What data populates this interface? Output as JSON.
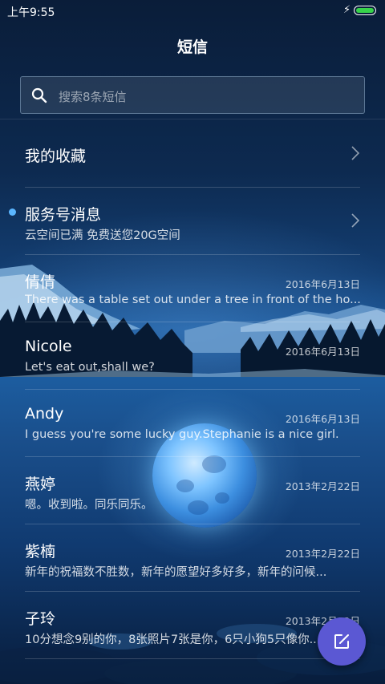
{
  "status_bar": {
    "time": "上午9:55"
  },
  "header": {
    "title": "短信"
  },
  "search": {
    "placeholder": "搜索8条短信"
  },
  "conversations": [
    {
      "name": "我的收藏",
      "snippet": "",
      "date": "",
      "chevron": true,
      "unread": false
    },
    {
      "name": "服务号消息",
      "snippet": "云空间已满 免费送您20G空间",
      "date": "",
      "chevron": true,
      "unread": true
    },
    {
      "name": "倩倩",
      "snippet": "There was a table set out under a tree in front of the ho...",
      "date": "2016年6月13日",
      "chevron": false,
      "unread": false
    },
    {
      "name": "Nicole",
      "snippet": "Let's eat out,shall we?",
      "date": "2016年6月13日",
      "chevron": false,
      "unread": false
    },
    {
      "name": "Andy",
      "snippet": "I guess you're some lucky guy.Stephanie is a nice girl.",
      "date": "2016年6月13日",
      "chevron": false,
      "unread": false
    },
    {
      "name": "燕婷",
      "snippet": "嗯。收到啦。同乐同乐。",
      "date": "2013年2月22日",
      "chevron": false,
      "unread": false
    },
    {
      "name": "紫楠",
      "snippet": "新年的祝福数不胜数，新年的愿望好多好多，新年的问候...",
      "date": "2013年2月22日",
      "chevron": false,
      "unread": false
    },
    {
      "name": "子玲",
      "snippet": "10分想念9别的你，8张照片7张是你，6只小狗5只像你...",
      "date": "2013年2月22日",
      "chevron": false,
      "unread": false
    }
  ],
  "icons": {
    "search": "search-icon",
    "compose": "compose-icon",
    "chevron": "chevron-right-icon",
    "charging": "charging-bolt-icon"
  },
  "colors": {
    "fab": "#5b58d3",
    "unread_dot": "#5bb6ff",
    "battery": "#37d34a"
  }
}
